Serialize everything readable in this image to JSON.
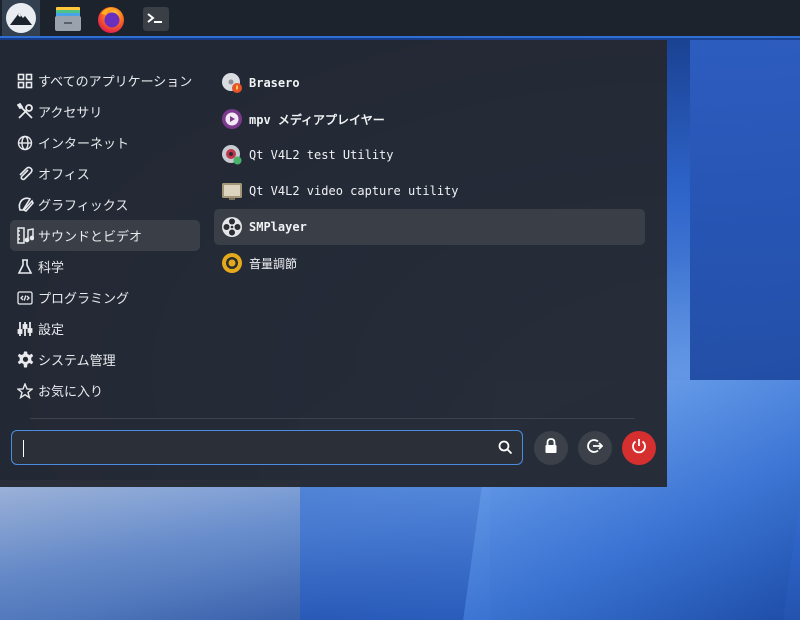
{
  "menu": {
    "categories": [
      {
        "label": "すべてのアプリケーション",
        "icon": "grid-icon"
      },
      {
        "label": "アクセサリ",
        "icon": "tools-icon"
      },
      {
        "label": "インターネット",
        "icon": "globe-icon"
      },
      {
        "label": "オフィス",
        "icon": "paperclip-icon"
      },
      {
        "label": "グラフィックス",
        "icon": "palette-icon"
      },
      {
        "label": "サウンドとビデオ",
        "icon": "film-music-icon"
      },
      {
        "label": "科学",
        "icon": "flask-icon"
      },
      {
        "label": "プログラミング",
        "icon": "code-icon"
      },
      {
        "label": "設定",
        "icon": "sliders-icon"
      },
      {
        "label": "システム管理",
        "icon": "gear-icon"
      },
      {
        "label": "お気に入り",
        "icon": "star-icon"
      }
    ],
    "active_category": "サウンドとビデオ",
    "apps": [
      {
        "label": "Brasero",
        "icon": "brasero-disc-icon"
      },
      {
        "label": "mpv メディアプレイヤー",
        "icon": "mpv-icon"
      },
      {
        "label": "Qt V4L2 test Utility",
        "icon": "qv4l2-icon"
      },
      {
        "label": "Qt V4L2 video capture utility",
        "icon": "video-capture-icon"
      },
      {
        "label": "SMPlayer",
        "icon": "smplayer-icon"
      },
      {
        "label": "音量調節",
        "icon": "volume-control-icon"
      }
    ],
    "hovered_app": "SMPlayer",
    "search": {
      "value": "",
      "placeholder": ""
    }
  },
  "colors": {
    "accent": "#2e6fd1",
    "menu_bg": "#242931",
    "power": "#d52f2f",
    "mpv": "#7b3a8e",
    "volume": "#e5a91c"
  }
}
